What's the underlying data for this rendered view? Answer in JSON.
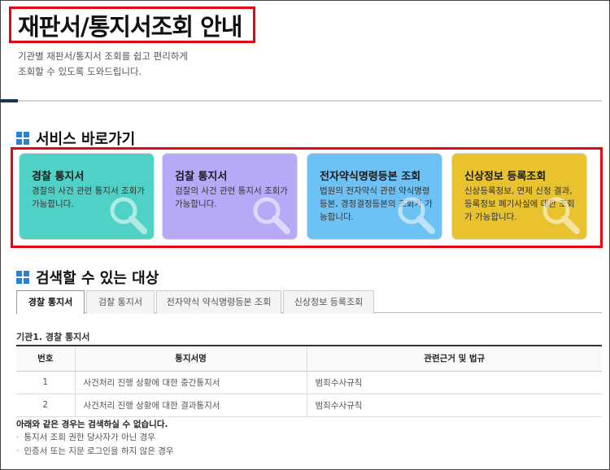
{
  "page": {
    "title": "재판서/통지서조회 안내",
    "intro_line1": "기관별 재판서/통지서 조회를 쉽고 편리하게",
    "intro_line2": "조회할 수 있도록 도와드립니다."
  },
  "shortcuts": {
    "heading": "서비스 바로가기",
    "cards": [
      {
        "title": "경찰 통지서",
        "desc": "경찰의 사건 관련 통지서 조회가 가능합니다.",
        "color": "#4fd1c5",
        "icon": "search-icon"
      },
      {
        "title": "검찰 통지서",
        "desc": "검찰의 사건 관련 통지서 조회가 가능합니다.",
        "color": "#b7a8f8",
        "icon": "search-icon"
      },
      {
        "title": "전자약식명령등본 조회",
        "desc": "법원의 전자약식 관련 약식명령등본, 경정결정등본의 조회가 가능합니다.",
        "color": "#6cc1f5",
        "icon": "search-icon"
      },
      {
        "title": "신상정보 등록조회",
        "desc": "신상등록정보, 면제 신청 결과, 등록정보 폐기사실에 대한 조회가 가능합니다.",
        "color": "#e8c32f",
        "icon": "search-icon"
      }
    ]
  },
  "searchable": {
    "heading": "검색할 수 있는 대상",
    "tabs": [
      "경찰 통지서",
      "검찰 통지서",
      "전자약식 약식명령등본 조회",
      "신상정보 등록조회"
    ],
    "active_tab": 0,
    "subheading": "기관1. 경찰 통지서",
    "columns": [
      "번호",
      "통지서명",
      "관련근거 및 법규"
    ],
    "rows": [
      {
        "no": "1",
        "name": "사건처리 진행 상황에 대한 중간통지서",
        "law": "범죄수사규칙"
      },
      {
        "no": "2",
        "name": "사건처리 진행 상황에 대한 결과통지서",
        "law": "범죄수사규칙"
      }
    ],
    "notice": "아래와 같은 경우는 검색하실 수 없습니다.",
    "bullets": [
      "통지서 조회 권한 당사자가 아닌 경우",
      "인증서 또는 지문 로그인을 하지 않은 경우"
    ]
  },
  "colors": {
    "accent_red": "#e30613",
    "brand_blue": "#2a82d6",
    "navy": "#1c3358"
  }
}
